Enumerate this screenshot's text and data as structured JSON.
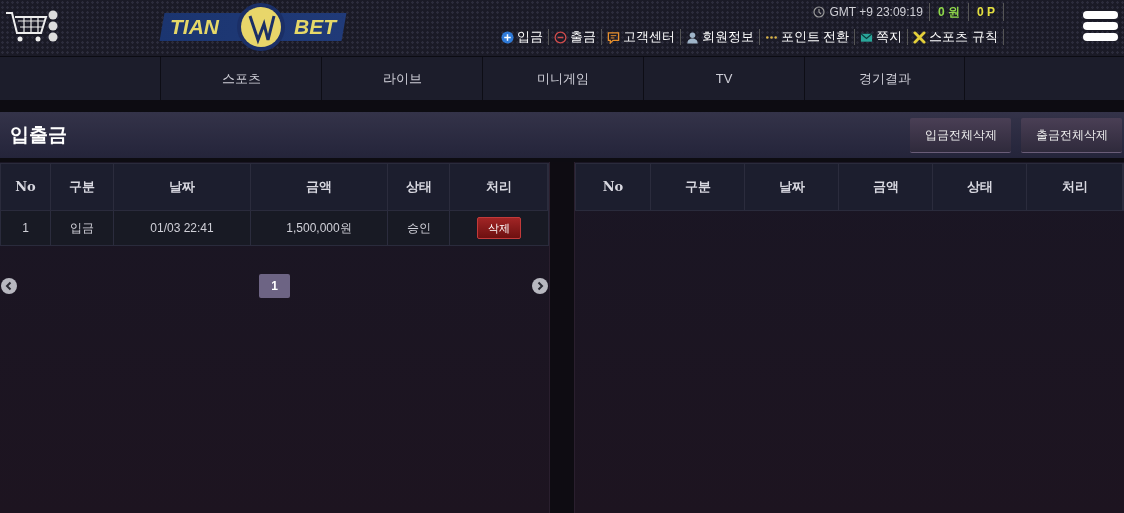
{
  "header": {
    "logo": {
      "left": "TIAN",
      "right": "BET"
    },
    "clock": "GMT +9 23:09:19",
    "balance": "0 원",
    "points": "0 P",
    "links": [
      {
        "label": "입금",
        "kind": "deposit"
      },
      {
        "label": "출금",
        "kind": "withdraw"
      },
      {
        "label": "고객센터",
        "kind": "support"
      },
      {
        "label": "회원정보",
        "kind": "member"
      },
      {
        "label": "포인트 전환",
        "kind": "points"
      },
      {
        "label": "쪽지",
        "kind": "message"
      },
      {
        "label": "스포츠 규칙",
        "kind": "rules"
      }
    ]
  },
  "nav": [
    {
      "label": "스포츠",
      "selected": false
    },
    {
      "label": "라이브",
      "selected": false
    },
    {
      "label": "미니게임",
      "selected": false
    },
    {
      "label": "TV",
      "selected": false
    },
    {
      "label": "경기결과",
      "selected": false
    }
  ],
  "title": "입출금",
  "actions": [
    "입금전체삭제",
    "출금전체삭제"
  ],
  "tables": [
    {
      "columns": [
        "No",
        "구분",
        "날짜",
        "금액",
        "상태",
        "처리"
      ],
      "rows": [
        {
          "no": "1",
          "type": "입금",
          "date": "01/03 22:41",
          "amount": "1,500,000원",
          "status": "승인",
          "action": "삭제"
        }
      ],
      "pages": [
        {
          "label": "1",
          "selected": true
        }
      ]
    },
    {
      "columns": [
        "No",
        "구분",
        "날짜",
        "금액",
        "상태",
        "처리"
      ]
    }
  ]
}
